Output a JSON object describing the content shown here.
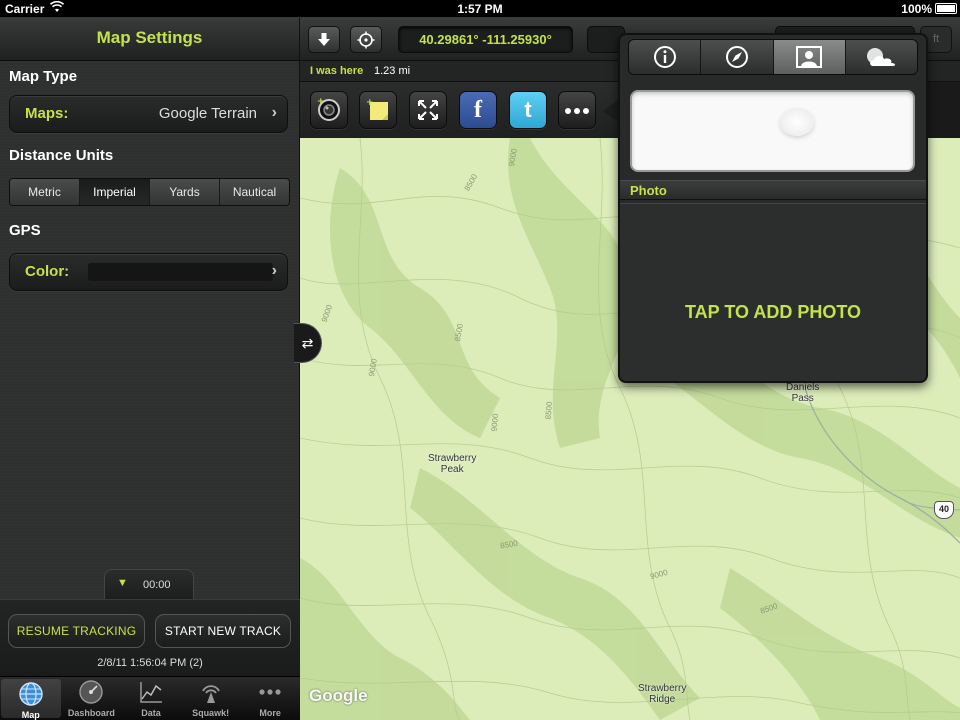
{
  "status_bar": {
    "carrier": "Carrier",
    "time": "1:57 PM",
    "battery": "100%"
  },
  "sidebar": {
    "title": "Map Settings",
    "map_type_label": "Map Type",
    "map_type_field": {
      "label": "Maps:",
      "value": "Google Terrain"
    },
    "distance_units_label": "Distance Units",
    "distance_units_options": [
      "Metric",
      "Imperial",
      "Yards",
      "Nautical"
    ],
    "distance_units_selected": "Imperial",
    "gps_label": "GPS",
    "color_field": {
      "label": "Color:"
    },
    "timer": "00:00",
    "resume_button": "RESUME TRACKING",
    "start_button": "START NEW TRACK",
    "track_timestamp": "2/8/11 1:56:04 PM (2)"
  },
  "tab_bar": {
    "items": [
      {
        "label": "Map",
        "icon": "globe-icon",
        "active": true
      },
      {
        "label": "Dashboard",
        "icon": "gauge-icon",
        "active": false
      },
      {
        "label": "Data",
        "icon": "chart-icon",
        "active": false
      },
      {
        "label": "Squawk!",
        "icon": "broadcast-icon",
        "active": false
      },
      {
        "label": "More",
        "icon": "more-icon",
        "active": false
      }
    ]
  },
  "toolbar": {
    "coordinates": "40.29861° -111.25930°",
    "unit_abbrev": "ft"
  },
  "location_bar": {
    "label": "I was here",
    "distance": "1.23 mi"
  },
  "map": {
    "labels": {
      "strawberry_peak": "Strawberry\nPeak",
      "strawberry_ridge": "Strawberry\nRidge",
      "daniels_pass": "Daniels\nPass",
      "highway": "40"
    },
    "contours": [
      "9000",
      "8500",
      "9000",
      "8500",
      "9000",
      "8500",
      "9000",
      "8500",
      "8500",
      "9000"
    ],
    "attribution": "Google"
  },
  "popover": {
    "tabs": [
      "info-icon",
      "compass-icon",
      "photo-icon",
      "weather-icon"
    ],
    "active_tab": "photo-icon",
    "section_label": "Photo",
    "tap_prompt": "TAP TO ADD PHOTO"
  },
  "colors": {
    "accent": "#c4e24a",
    "panel": "#2e2f2f",
    "map_bg": "#d9ecb6",
    "facebook": "#3b5998",
    "twitter": "#33bbe6"
  }
}
